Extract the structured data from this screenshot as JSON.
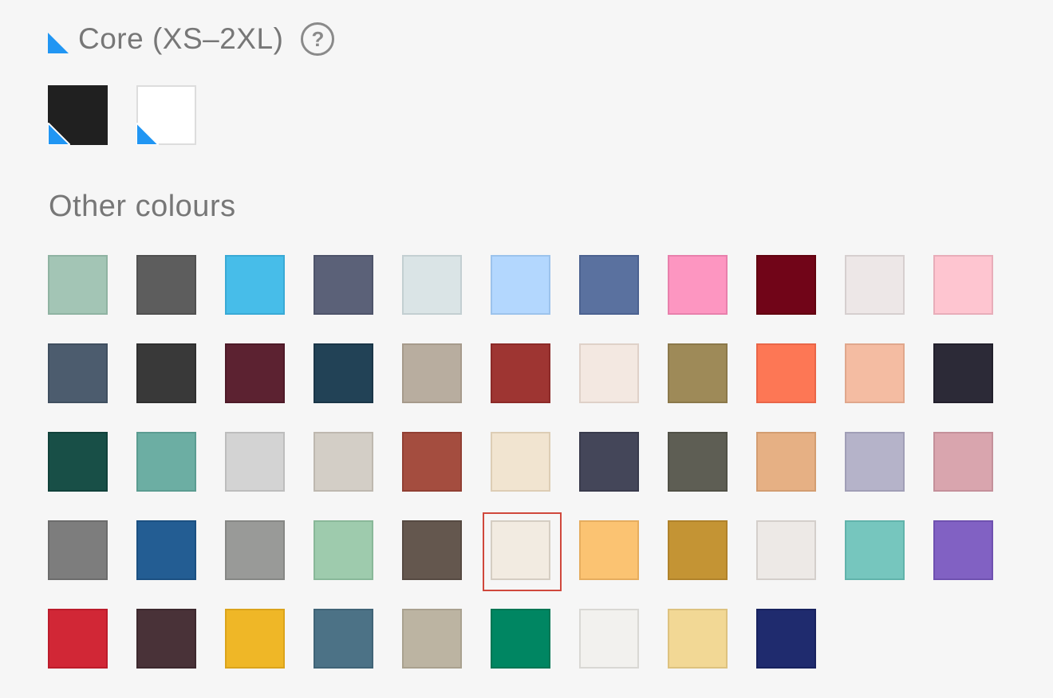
{
  "core": {
    "title": "Core (XS–2XL)",
    "help_label": "?",
    "accent_color": "#2196f3",
    "swatches": [
      {
        "color": "#202020",
        "border": "#202020"
      },
      {
        "color": "#ffffff",
        "border": "#dddddd"
      }
    ]
  },
  "other": {
    "title": "Other colours",
    "selected_index": 38,
    "selection_color": "#d0483c",
    "swatches": [
      {
        "color": "#a3c5b5",
        "border": "#8fb3a2"
      },
      {
        "color": "#5d5d5d",
        "border": "#505050"
      },
      {
        "color": "#47bde9",
        "border": "#3aaad5"
      },
      {
        "color": "#5b6178",
        "border": "#4e546a"
      },
      {
        "color": "#dae4e6",
        "border": "#c3cfd2"
      },
      {
        "color": "#b3d7fe",
        "border": "#9cc3ec"
      },
      {
        "color": "#5a719f",
        "border": "#4c6290"
      },
      {
        "color": "#fd96c1",
        "border": "#e880ac"
      },
      {
        "color": "#710518",
        "border": "#62030f"
      },
      {
        "color": "#ede7e7",
        "border": "#d6cfcf"
      },
      {
        "color": "#fec5d0",
        "border": "#e8adb9"
      },
      {
        "color": "#4c5c6e",
        "border": "#404f60"
      },
      {
        "color": "#393939",
        "border": "#2f2f2f"
      },
      {
        "color": "#5c2231",
        "border": "#4e1a28"
      },
      {
        "color": "#224256",
        "border": "#1a3648"
      },
      {
        "color": "#b8ad9f",
        "border": "#a69a8b"
      },
      {
        "color": "#9e3532",
        "border": "#8c2a28"
      },
      {
        "color": "#f3e8e1",
        "border": "#dfd1c8"
      },
      {
        "color": "#9e8a58",
        "border": "#8b784a"
      },
      {
        "color": "#fd7755",
        "border": "#e96648"
      },
      {
        "color": "#f4bca2",
        "border": "#e0a78c"
      },
      {
        "color": "#2c2a37",
        "border": "#22202c"
      },
      {
        "color": "#184f47",
        "border": "#11423b"
      },
      {
        "color": "#6caea3",
        "border": "#5b9c91"
      },
      {
        "color": "#d3d3d3",
        "border": "#bdbdbd"
      },
      {
        "color": "#d3cec6",
        "border": "#beb8af"
      },
      {
        "color": "#a44d3f",
        "border": "#913f33"
      },
      {
        "color": "#f1e4d0",
        "border": "#ddcdb5"
      },
      {
        "color": "#444659",
        "border": "#393b4c"
      },
      {
        "color": "#5e5e54",
        "border": "#515147"
      },
      {
        "color": "#e6b084",
        "border": "#d39d71"
      },
      {
        "color": "#b5b3c9",
        "border": "#a09eb6"
      },
      {
        "color": "#d9a5ae",
        "border": "#c4909a"
      },
      {
        "color": "#7d7d7d",
        "border": "#6c6c6c"
      },
      {
        "color": "#235d93",
        "border": "#1b5082"
      },
      {
        "color": "#999a98",
        "border": "#868785"
      },
      {
        "color": "#9ecbad",
        "border": "#89b899"
      },
      {
        "color": "#64574e",
        "border": "#564a42"
      },
      {
        "color": "#f2ebe1",
        "border": "#d5cdc2"
      },
      {
        "color": "#fbc372",
        "border": "#e6ad5e"
      },
      {
        "color": "#c49434",
        "border": "#b0822a"
      },
      {
        "color": "#ede9e6",
        "border": "#d4cfcb"
      },
      {
        "color": "#76c6be",
        "border": "#61b3ab"
      },
      {
        "color": "#8161c3",
        "border": "#6f51b0"
      },
      {
        "color": "#d12736",
        "border": "#bc1c2b"
      },
      {
        "color": "#493238",
        "border": "#3d292e"
      },
      {
        "color": "#efb727",
        "border": "#dba41c"
      },
      {
        "color": "#4c7286",
        "border": "#406477"
      },
      {
        "color": "#bcb4a2",
        "border": "#a9a18f"
      },
      {
        "color": "#008662",
        "border": "#007654"
      },
      {
        "color": "#f2f1ee",
        "border": "#d9d8d4"
      },
      {
        "color": "#f2d895",
        "border": "#ddc27f"
      },
      {
        "color": "#1f2b6e",
        "border": "#18225f"
      }
    ]
  }
}
